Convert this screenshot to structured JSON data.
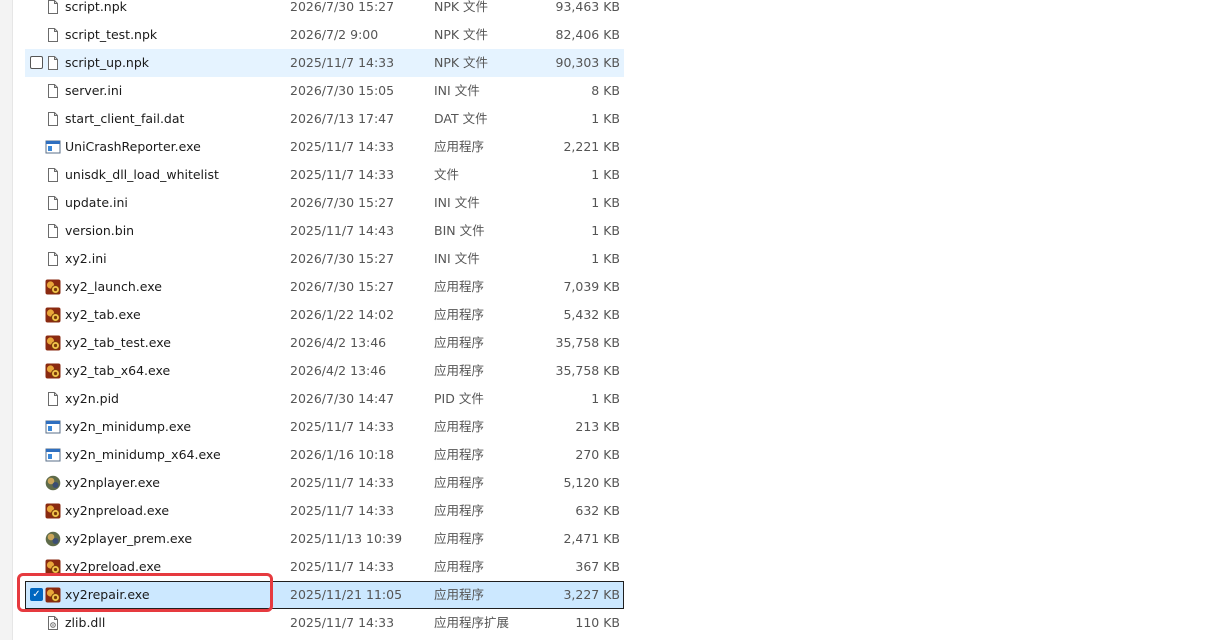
{
  "files": [
    {
      "name": "script.npk",
      "date": "2026/7/30 15:27",
      "type": "NPK 文件",
      "size": "93,463 KB",
      "icon": "file-icon"
    },
    {
      "name": "script_test.npk",
      "date": "2026/7/2 9:00",
      "type": "NPK 文件",
      "size": "82,406 KB",
      "icon": "file-icon"
    },
    {
      "name": "script_up.npk",
      "date": "2025/11/7 14:33",
      "type": "NPK 文件",
      "size": "90,303 KB",
      "icon": "file-icon",
      "state": "hover"
    },
    {
      "name": "server.ini",
      "date": "2026/7/30 15:05",
      "type": "INI 文件",
      "size": "8 KB",
      "icon": "file-icon"
    },
    {
      "name": "start_client_fail.dat",
      "date": "2026/7/13 17:47",
      "type": "DAT 文件",
      "size": "1 KB",
      "icon": "file-icon"
    },
    {
      "name": "UniCrashReporter.exe",
      "date": "2025/11/7 14:33",
      "type": "应用程序",
      "size": "2,221 KB",
      "icon": "app-window-icon"
    },
    {
      "name": "unisdk_dll_load_whitelist",
      "date": "2025/11/7 14:33",
      "type": "文件",
      "size": "1 KB",
      "icon": "file-icon"
    },
    {
      "name": "update.ini",
      "date": "2026/7/30 15:27",
      "type": "INI 文件",
      "size": "1 KB",
      "icon": "file-icon"
    },
    {
      "name": "version.bin",
      "date": "2025/11/7 14:43",
      "type": "BIN 文件",
      "size": "1 KB",
      "icon": "file-icon"
    },
    {
      "name": "xy2.ini",
      "date": "2026/7/30 15:27",
      "type": "INI 文件",
      "size": "1 KB",
      "icon": "file-icon"
    },
    {
      "name": "xy2_launch.exe",
      "date": "2026/7/30 15:27",
      "type": "应用程序",
      "size": "7,039 KB",
      "icon": "game-icon"
    },
    {
      "name": "xy2_tab.exe",
      "date": "2026/1/22 14:02",
      "type": "应用程序",
      "size": "5,432 KB",
      "icon": "game-icon"
    },
    {
      "name": "xy2_tab_test.exe",
      "date": "2026/4/2 13:46",
      "type": "应用程序",
      "size": "35,758 KB",
      "icon": "game-icon"
    },
    {
      "name": "xy2_tab_x64.exe",
      "date": "2026/4/2 13:46",
      "type": "应用程序",
      "size": "35,758 KB",
      "icon": "game-icon"
    },
    {
      "name": "xy2n.pid",
      "date": "2026/7/30 14:47",
      "type": "PID 文件",
      "size": "1 KB",
      "icon": "file-icon"
    },
    {
      "name": "xy2n_minidump.exe",
      "date": "2025/11/7 14:33",
      "type": "应用程序",
      "size": "213 KB",
      "icon": "app-window-icon"
    },
    {
      "name": "xy2n_minidump_x64.exe",
      "date": "2026/1/16 10:18",
      "type": "应用程序",
      "size": "270 KB",
      "icon": "app-window-icon"
    },
    {
      "name": "xy2nplayer.exe",
      "date": "2025/11/7 14:33",
      "type": "应用程序",
      "size": "5,120 KB",
      "icon": "player-icon"
    },
    {
      "name": "xy2npreload.exe",
      "date": "2025/11/7 14:33",
      "type": "应用程序",
      "size": "632 KB",
      "icon": "game-icon"
    },
    {
      "name": "xy2player_prem.exe",
      "date": "2025/11/13 10:39",
      "type": "应用程序",
      "size": "2,471 KB",
      "icon": "player-icon"
    },
    {
      "name": "xy2preload.exe",
      "date": "2025/11/7 14:33",
      "type": "应用程序",
      "size": "367 KB",
      "icon": "game-icon"
    },
    {
      "name": "xy2repair.exe",
      "date": "2025/11/21 11:05",
      "type": "应用程序",
      "size": "3,227 KB",
      "icon": "game-icon",
      "state": "selected"
    },
    {
      "name": "zlib.dll",
      "date": "2025/11/7 14:33",
      "type": "应用程序扩展",
      "size": "110 KB",
      "icon": "dll-icon"
    }
  ],
  "colors": {
    "selection": "#cce8ff",
    "hover": "#e5f3ff",
    "annotation": "#e63a3f",
    "accent": "#0067c0"
  }
}
